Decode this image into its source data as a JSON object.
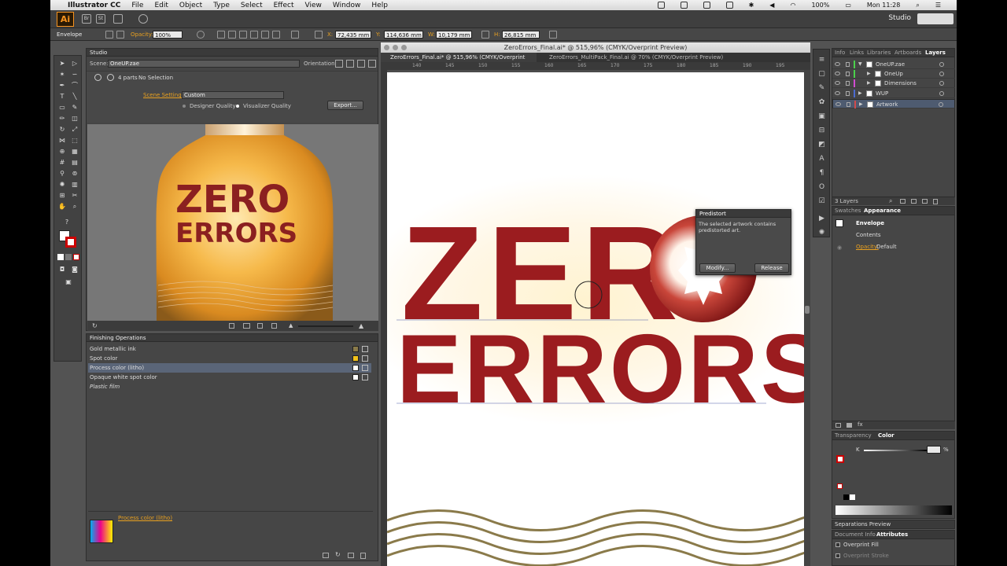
{
  "menubar": {
    "app_name": "Illustrator CC",
    "items": [
      "File",
      "Edit",
      "Object",
      "Type",
      "Select",
      "Effect",
      "View",
      "Window",
      "Help"
    ],
    "battery": "100%",
    "clock": "Mon 11:28"
  },
  "appbar": {
    "logo": "Ai",
    "br_label": "Br",
    "st_label": "St",
    "workspace": "Studio"
  },
  "control": {
    "selection_type": "Envelope",
    "opacity_label": "Opacity:",
    "opacity_value": "100%",
    "x_label": "X:",
    "x_value": "72,435 mm",
    "y_label": "Y:",
    "y_value": "114,636 mm",
    "w_label": "W:",
    "w_value": "10,179 mm",
    "h_label": "H:",
    "h_value": "26,815 mm"
  },
  "studio": {
    "title": "Studio",
    "scene_label": "Scene:",
    "scene_value": "OneUP.zae",
    "orientation_label": "Orientation:",
    "parts": "4 parts",
    "selection": "No Selection",
    "scene_settings_label": "Scene Settings:",
    "scene_settings_value": "Custom",
    "designer_quality": "Designer Quality",
    "visualizer_quality": "Visualizer Quality",
    "export_button": "Export...",
    "bottle_word1": "ZERO",
    "bottle_word2": "ERRORS"
  },
  "finishing": {
    "title": "Finishing Operations",
    "rows": [
      {
        "label": "Gold metallic ink",
        "color": "#8a7a4a"
      },
      {
        "label": "Spot color",
        "color": "#f2c21a"
      },
      {
        "label": "Process color (litho)",
        "color": "#ffffff"
      },
      {
        "label": "Opaque white spot color",
        "color": "#ffffff"
      },
      {
        "label": "Plastic film",
        "color": ""
      }
    ],
    "selected_label": "Process color (litho)"
  },
  "document": {
    "window_title": "ZeroErrors_Final.ai* @ 515,96% (CMYK/Overprint Preview)",
    "tabs": [
      "ZeroErrors_Final.ai* @ 515,96% (CMYK/Overprint Preview)",
      "ZeroErrors_MultiPack_Final.ai @ 70% (CMYK/Overprint Preview)"
    ],
    "ruler_ticks": [
      "140",
      "145",
      "150",
      "155",
      "160",
      "165",
      "170",
      "175",
      "180",
      "185",
      "190",
      "195"
    ],
    "art_word1": "ZER",
    "art_word2": "ERRORS",
    "brand_red": "#9b1c1f"
  },
  "predistort": {
    "title": "Predistort",
    "message": "The selected artwork contains predistorted art.",
    "modify_button": "Modify...",
    "release_button": "Release"
  },
  "layers": {
    "tabs": [
      "Info",
      "Links",
      "Libraries",
      "Artboards",
      "Layers"
    ],
    "rows": [
      {
        "name": "OneUP.zae",
        "color": "#4bd14b",
        "indent": 0
      },
      {
        "name": "OneUp",
        "color": "#4bd14b",
        "indent": 1
      },
      {
        "name": "Dimensions",
        "color": "#d14bd1",
        "indent": 1
      },
      {
        "name": "WUP",
        "color": "#4b6bd1",
        "indent": 0
      },
      {
        "name": "Artwork",
        "color": "#d14b4b",
        "indent": 0
      }
    ],
    "count": "3 Layers"
  },
  "appearance": {
    "tabs": [
      "Swatches",
      "Appearance"
    ],
    "object": "Envelope",
    "contents": "Contents",
    "opacity_label": "Opacity:",
    "opacity_value": "Default"
  },
  "color": {
    "tabs": [
      "Transparency",
      "Color"
    ],
    "channel": "K",
    "pct": "%"
  },
  "separations": {
    "title": "Separations Preview"
  },
  "attributes": {
    "tabs": [
      "Document Info",
      "Attributes"
    ],
    "overprint_fill": "Overprint Fill",
    "overprint_stroke": "Overprint Stroke"
  }
}
